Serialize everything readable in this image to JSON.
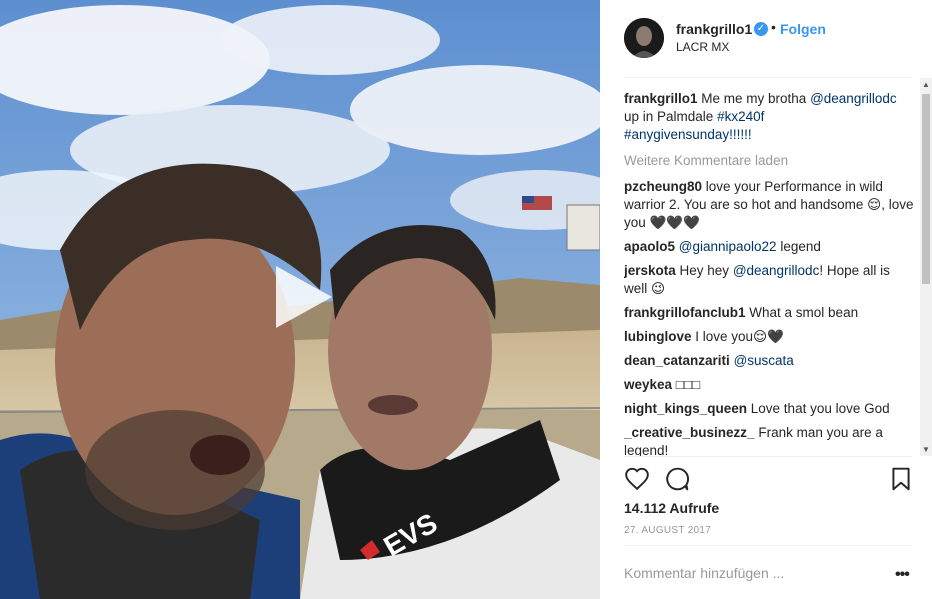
{
  "header": {
    "username": "frankgrillo1",
    "separator": "•",
    "follow_label": "Folgen",
    "location": "LACR MX"
  },
  "caption": {
    "user": "frankgrillo1",
    "text_1": " Me me my brotha ",
    "mention": "@deangrillodc",
    "text_2": " up in Palmdale ",
    "hashtag_1": "#kx240f",
    "hashtag_2": "#anygivensunday!!!!!!"
  },
  "load_more_label": "Weitere Kommentare laden",
  "comments": [
    {
      "user": "pzcheung80",
      "text": " love your Performance in wild warrior 2. You are so hot and handsome 😌, love you 🖤🖤🖤"
    },
    {
      "user": "apaolo5",
      "mention": "@giannipaolo22",
      "text": " legend"
    },
    {
      "user": "jerskota",
      "text": " Hey hey ",
      "mention": "@deangrillodc",
      "text_after": "! Hope all is well 😉"
    },
    {
      "user": "frankgrillofanclub1",
      "text": " What a smol bean"
    },
    {
      "user": "lubinglove",
      "text": " I love you😌🖤"
    },
    {
      "user": "dean_catanzariti",
      "mention": "@suscata",
      "text": ""
    },
    {
      "user": "weykea",
      "text": " □□□"
    },
    {
      "user": "night_kings_queen",
      "text": " Love that you love God"
    },
    {
      "user": "_creative_businezz_",
      "text": " Frank man you are a legend!"
    }
  ],
  "icons": {
    "like": "heart-icon",
    "comment": "comment-icon",
    "save": "bookmark-icon",
    "play": "play-icon",
    "verified": "verified-icon",
    "more": "more-options-icon"
  },
  "views": "14.112 Aufrufe",
  "date": "27. AUGUST 2017",
  "add_comment_placeholder": "Kommentar hinzufügen ...",
  "more_label": "•••",
  "colors": {
    "accent": "#3897f0",
    "mention": "#003569",
    "muted": "#999999"
  }
}
